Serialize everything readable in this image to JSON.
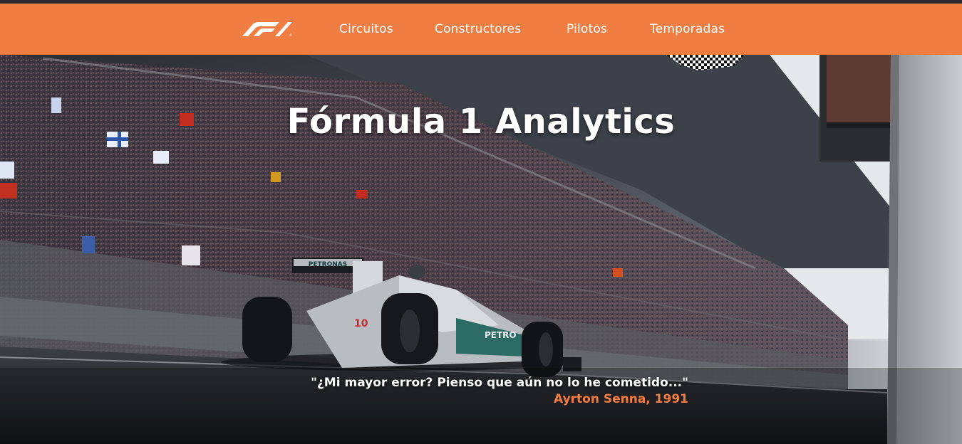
{
  "header": {
    "logo_icon": "f1-logo-icon",
    "nav": [
      {
        "label": "Circuitos"
      },
      {
        "label": "Constructores"
      },
      {
        "label": "Pilotos"
      },
      {
        "label": "Temporadas"
      }
    ]
  },
  "hero": {
    "title": "Fórmula 1 Analytics",
    "quote": "\"¿Mi mayor error? Pienso que aún no lo he cometido...\"",
    "author": "Ayrton Senna, 1991",
    "background": "race-track-grandstand-photo",
    "car_livery": "PETRONAS",
    "car_number": "10"
  },
  "colors": {
    "accent": "#f07d42",
    "text": "#ffffff"
  }
}
